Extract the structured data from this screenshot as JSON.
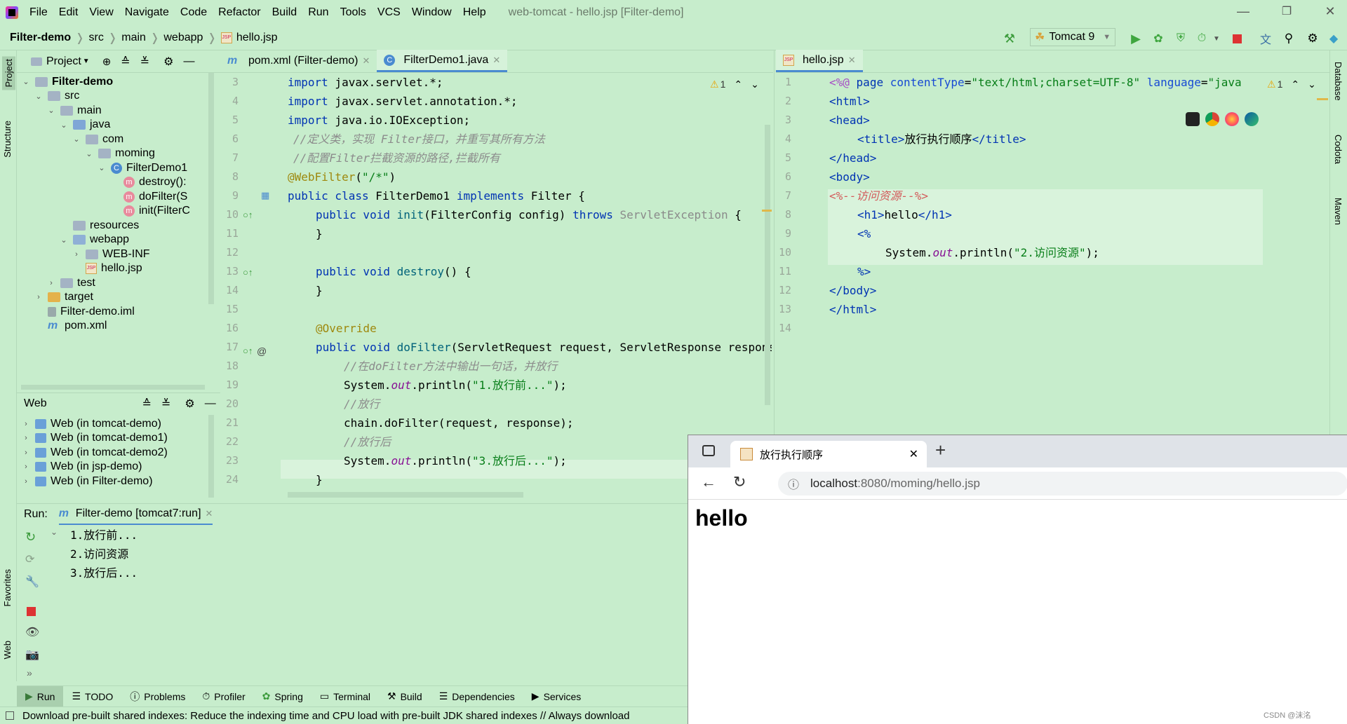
{
  "menu": {
    "items": [
      "File",
      "Edit",
      "View",
      "Navigate",
      "Code",
      "Refactor",
      "Build",
      "Run",
      "Tools",
      "VCS",
      "Window",
      "Help"
    ],
    "window_title": "web-tomcat - hello.jsp [Filter-demo]"
  },
  "nav": {
    "crumbs": [
      "Filter-demo",
      "src",
      "main",
      "webapp",
      "hello.jsp"
    ],
    "run_config": "Tomcat 9"
  },
  "strips": {
    "left": [
      "Project",
      "Structure",
      "Favorites",
      "Web"
    ],
    "right": [
      "Database",
      "Codota",
      "Maven"
    ]
  },
  "project": {
    "title": "Project",
    "tree": [
      {
        "label": "Filter-demo",
        "depth": 0,
        "icon": "folder",
        "chev": "down",
        "bold": true
      },
      {
        "label": "src",
        "depth": 1,
        "icon": "folder",
        "chev": "down"
      },
      {
        "label": "main",
        "depth": 2,
        "icon": "folder",
        "chev": "down"
      },
      {
        "label": "java",
        "depth": 3,
        "icon": "folder-blue",
        "chev": "down"
      },
      {
        "label": "com",
        "depth": 4,
        "icon": "package",
        "chev": "down"
      },
      {
        "label": "moming",
        "depth": 5,
        "icon": "package",
        "chev": "down"
      },
      {
        "label": "FilterDemo1",
        "depth": 6,
        "icon": "class",
        "chev": "down"
      },
      {
        "label": "destroy():",
        "depth": 7,
        "icon": "method",
        "chev": ""
      },
      {
        "label": "doFilter(S",
        "depth": 7,
        "icon": "method",
        "chev": ""
      },
      {
        "label": "init(FilterC",
        "depth": 7,
        "icon": "method",
        "chev": ""
      },
      {
        "label": "resources",
        "depth": 3,
        "icon": "folder-res",
        "chev": ""
      },
      {
        "label": "webapp",
        "depth": 3,
        "icon": "folder-web",
        "chev": "down"
      },
      {
        "label": "WEB-INF",
        "depth": 4,
        "icon": "folder",
        "chev": "right"
      },
      {
        "label": "hello.jsp",
        "depth": 4,
        "icon": "jsp",
        "chev": ""
      },
      {
        "label": "test",
        "depth": 2,
        "icon": "folder",
        "chev": "right"
      },
      {
        "label": "target",
        "depth": 1,
        "icon": "folder-yellow",
        "chev": "right"
      },
      {
        "label": "Filter-demo.iml",
        "depth": 1,
        "icon": "iml",
        "chev": ""
      },
      {
        "label": "pom.xml",
        "depth": 1,
        "icon": "xml",
        "chev": ""
      }
    ]
  },
  "web": {
    "title": "Web",
    "items": [
      "Web (in tomcat-demo)",
      "Web (in tomcat-demo1)",
      "Web (in tomcat-demo2)",
      "Web (in jsp-demo)",
      "Web (in Filter-demo)"
    ]
  },
  "editor1": {
    "tabs": [
      {
        "label": "pom.xml (Filter-demo)",
        "icon": "m"
      },
      {
        "label": "FilterDemo1.java",
        "icon": "C"
      }
    ],
    "warn": "1",
    "line_numbers": [
      "3",
      "4",
      "5",
      "6",
      "7",
      "8",
      "9",
      "10",
      "11",
      "12",
      "13",
      "14",
      "15",
      "16",
      "17",
      "18",
      "19",
      "20",
      "21",
      "22",
      "23",
      "24"
    ]
  },
  "editor2": {
    "tabs": [
      {
        "label": "hello.jsp",
        "icon": "jsp"
      }
    ],
    "warn": "1",
    "line_numbers": [
      "1",
      "2",
      "3",
      "4",
      "5",
      "6",
      "7",
      "8",
      "9",
      "10",
      "11",
      "12",
      "13",
      "14"
    ]
  },
  "run": {
    "label": "Run:",
    "tab": "Filter-demo [tomcat7:run]",
    "output": [
      "1.放行前...",
      "2.访问资源",
      "3.放行后..."
    ]
  },
  "bottom_tabs": [
    "Run",
    "TODO",
    "Problems",
    "Profiler",
    "Spring",
    "Terminal",
    "Build",
    "Dependencies",
    "Services"
  ],
  "status": "Download pre-built shared indexes: Reduce the indexing time and CPU load with pre-built JDK shared indexes // Always download",
  "browser": {
    "tab_title": "放行执行顺序",
    "url_host": "localhost",
    "url_rest": ":8080/moming/hello.jsp",
    "content": "hello"
  },
  "watermark": "CSDN @沫洺",
  "colors": {
    "bg": "#c7edcc",
    "keyword": "#0033b3",
    "string": "#067d17",
    "accent": "#4a8bd0"
  }
}
